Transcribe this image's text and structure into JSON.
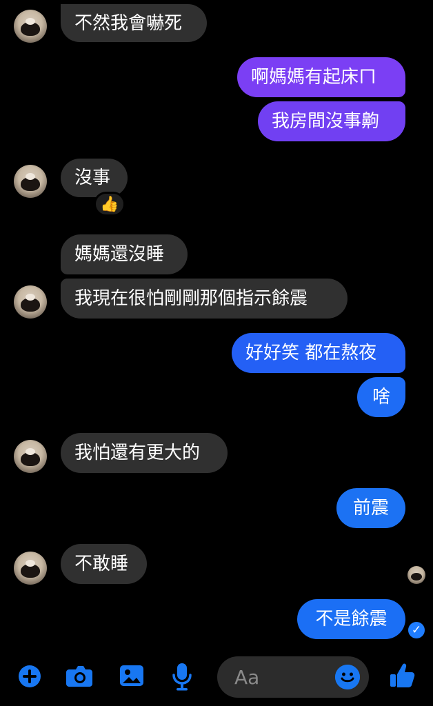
{
  "messages": [
    {
      "id": "m1",
      "text": "不然我會嚇死",
      "side": "in"
    },
    {
      "id": "m2",
      "text": "啊媽媽有起床ㄇ",
      "side": "out"
    },
    {
      "id": "m3",
      "text": "我房間沒事齁",
      "side": "out"
    },
    {
      "id": "m4",
      "text": "沒事",
      "side": "in",
      "reaction": "👍"
    },
    {
      "id": "m5",
      "text": "媽媽還沒睡",
      "side": "in"
    },
    {
      "id": "m6",
      "text": "我現在很怕剛剛那個指示餘震",
      "side": "in"
    },
    {
      "id": "m7",
      "text": "好好笑 都在熬夜",
      "side": "out"
    },
    {
      "id": "m8",
      "text": "啥",
      "side": "out"
    },
    {
      "id": "m9",
      "text": "我怕還有更大的",
      "side": "in"
    },
    {
      "id": "m10",
      "text": "前震",
      "side": "out"
    },
    {
      "id": "m11",
      "text": "不敢睡",
      "side": "in"
    },
    {
      "id": "m12",
      "text": "不是餘震",
      "side": "out"
    }
  ],
  "composer": {
    "placeholder": "Aa"
  },
  "status": {
    "seen": "✓"
  },
  "icons": {
    "add": "plus-icon",
    "camera": "camera-icon",
    "gallery": "image-icon",
    "microphone": "microphone-icon",
    "emoji": "emoji-icon",
    "like": "thumbs-up-icon",
    "reaction": "thumbs-up-reaction-icon"
  },
  "colors": {
    "background": "#000000",
    "incoming_bubble": "#303030",
    "outgoing_purple": "#7a3ff2",
    "outgoing_blue": "#1d6ff0",
    "accent_blue": "#1877f2"
  }
}
